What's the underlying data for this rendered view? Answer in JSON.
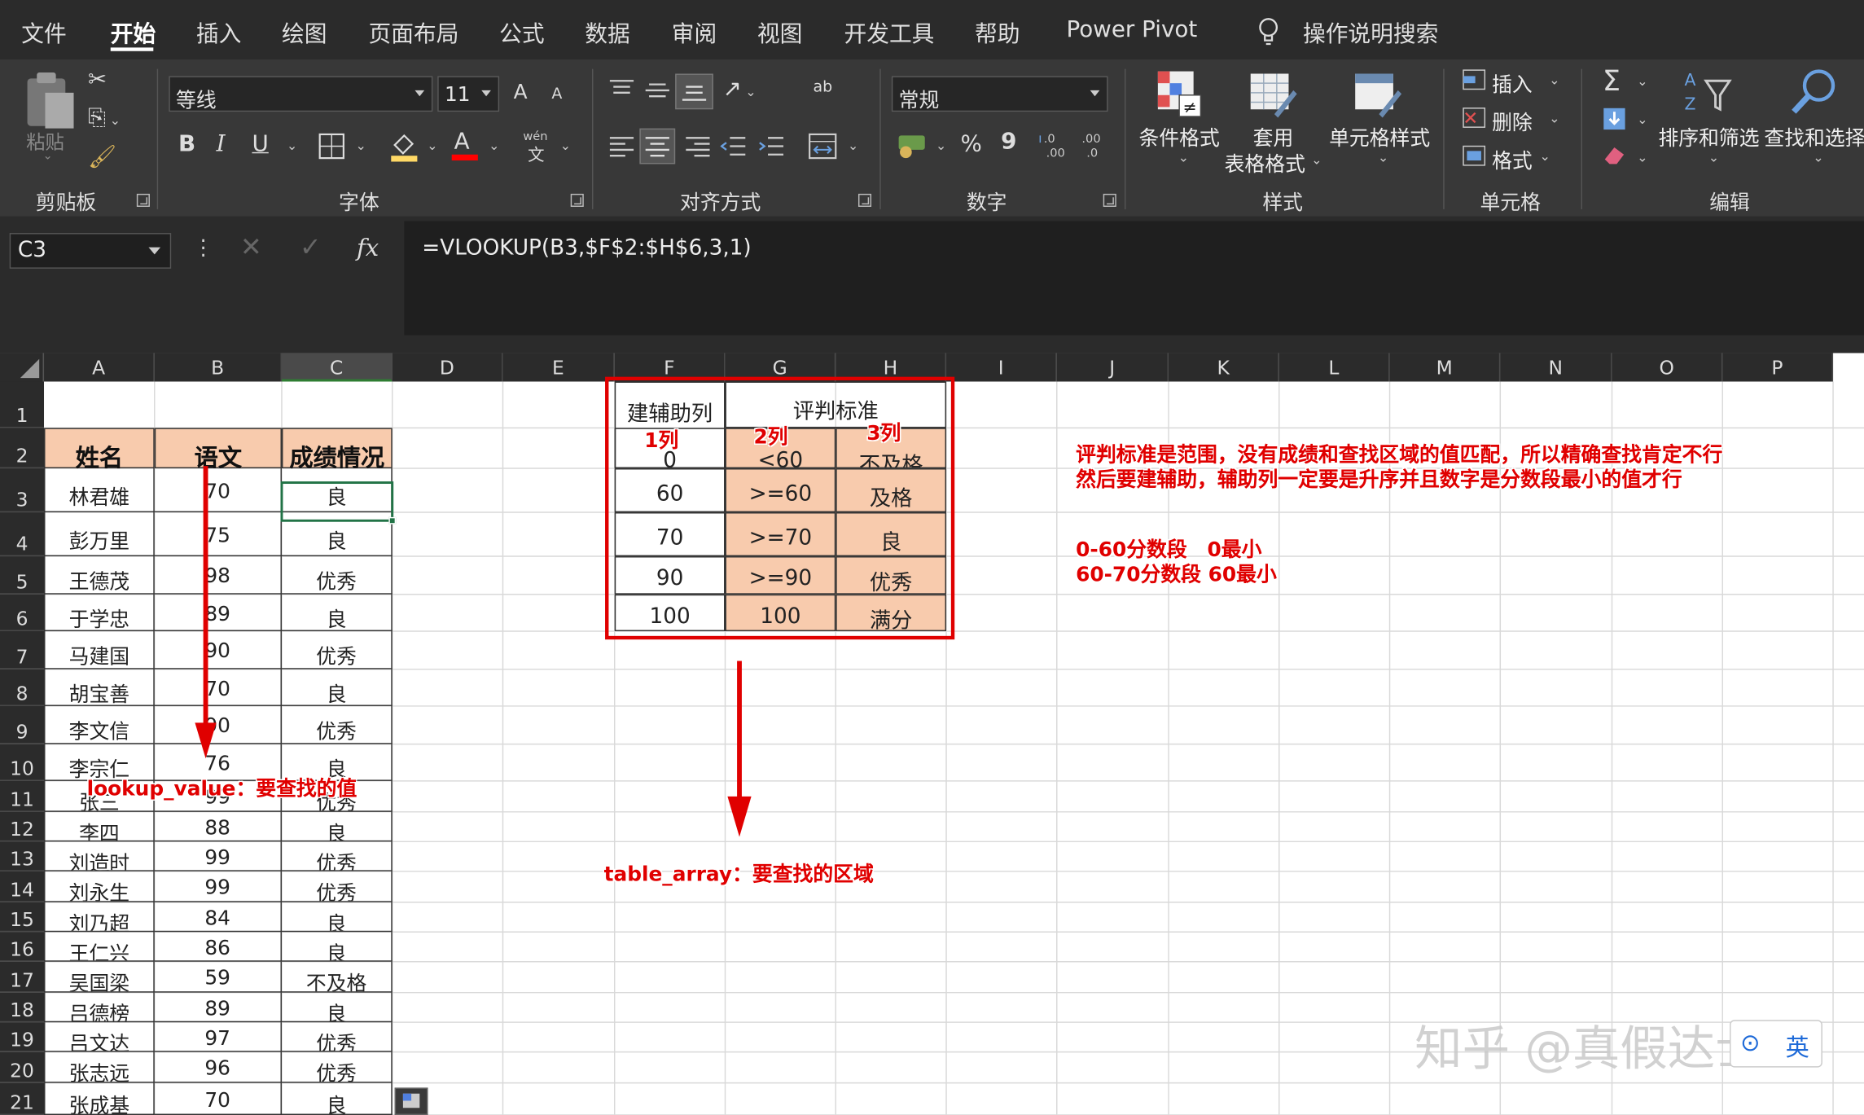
{
  "menu": {
    "tabs": [
      "文件",
      "开始",
      "插入",
      "绘图",
      "页面布局",
      "公式",
      "数据",
      "审阅",
      "视图",
      "开发工具",
      "帮助",
      "Power Pivot"
    ],
    "tell_me": "操作说明搜索"
  },
  "ribbon": {
    "clipboard": {
      "label": "剪贴板",
      "paste": "粘贴"
    },
    "font": {
      "label": "字体",
      "name": "等线",
      "size": "11",
      "bold": "B",
      "italic": "I",
      "underline": "U",
      "grow": "A",
      "shrink": "A",
      "phonetic_top": "wén",
      "phonetic_bottom": "文",
      "color_a": "A"
    },
    "alignment": {
      "label": "对齐方式",
      "wrap": "ab"
    },
    "number": {
      "label": "数字",
      "format": "常规",
      "percent": "%",
      "comma": "9",
      "inc": ".0→.00",
      "dec": ".00→.0"
    },
    "styles": {
      "label": "样式",
      "conditional": "条件格式",
      "table_line1": "套用",
      "table_line2": "表格格式",
      "cell_styles": "单元格样式"
    },
    "cells": {
      "label": "单元格",
      "insert": "插入",
      "delete": "删除",
      "format": "格式"
    },
    "editing": {
      "label": "编辑",
      "sum": "Σ",
      "sort": "排序和筛选",
      "find": "查找和选择"
    }
  },
  "formula_bar": {
    "name_box": "C3",
    "fx": "fx",
    "formula": "=VLOOKUP(B3,$F$2:$H$6,3,1)"
  },
  "columns": [
    "A",
    "B",
    "C",
    "D",
    "E",
    "F",
    "G",
    "H",
    "I",
    "J",
    "K",
    "L",
    "M",
    "N",
    "O",
    "P"
  ],
  "rows": [
    "1",
    "2",
    "3",
    "4",
    "5",
    "6",
    "7",
    "8",
    "9",
    "10",
    "11",
    "12",
    "13",
    "14",
    "15",
    "16",
    "17",
    "18",
    "19",
    "20",
    "21"
  ],
  "table": {
    "headers": [
      "姓名",
      "语文",
      "成绩情况"
    ],
    "data": [
      [
        "林君雄",
        "70",
        "良"
      ],
      [
        "彭万里",
        "75",
        "良"
      ],
      [
        "王德茂",
        "98",
        "优秀"
      ],
      [
        "于学忠",
        "89",
        "良"
      ],
      [
        "马建国",
        "90",
        "优秀"
      ],
      [
        "胡宝善",
        "70",
        "良"
      ],
      [
        "李文信",
        "90",
        "优秀"
      ],
      [
        "李宗仁",
        "76",
        "良"
      ],
      [
        "张三",
        "99",
        "优秀"
      ],
      [
        "李四",
        "88",
        "良"
      ],
      [
        "刘造时",
        "99",
        "优秀"
      ],
      [
        "刘永生",
        "99",
        "优秀"
      ],
      [
        "刘乃超",
        "84",
        "良"
      ],
      [
        "王仁兴",
        "86",
        "良"
      ],
      [
        "吴国梁",
        "59",
        "不及格"
      ],
      [
        "吕德榜",
        "89",
        "良"
      ],
      [
        "吕文达",
        "97",
        "优秀"
      ],
      [
        "张志远",
        "96",
        "优秀"
      ],
      [
        "张成基",
        "70",
        "良"
      ]
    ]
  },
  "criteria": {
    "aux_header": "建辅助列",
    "header": "评判标准",
    "rows": [
      [
        "0",
        "<60",
        "不及格"
      ],
      [
        "60",
        ">=60",
        "及格"
      ],
      [
        "70",
        ">=70",
        "良"
      ],
      [
        "90",
        ">=90",
        "优秀"
      ],
      [
        "100",
        "100",
        "满分"
      ]
    ],
    "col_tags": [
      "1列",
      "2列",
      "3列"
    ]
  },
  "annotations": {
    "note_line1": "评判标准是范围，没有成绩和查找区域的值匹配，所以精确查找肯定不行",
    "note_line2": "然后要建辅助，辅助列一定要是升序并且数字是分数段最小的值才行",
    "range1": "0-60分数段　0最小",
    "range2": "60-70分数段  60最小",
    "lookup_value": "lookup_value：要查找的值",
    "table_array": "table_array：要查找的区域"
  },
  "watermark": "知乎 @真假达士",
  "colors": {
    "accent": "#e00000",
    "highlight": "#f8cbad",
    "selection": "#217346"
  }
}
